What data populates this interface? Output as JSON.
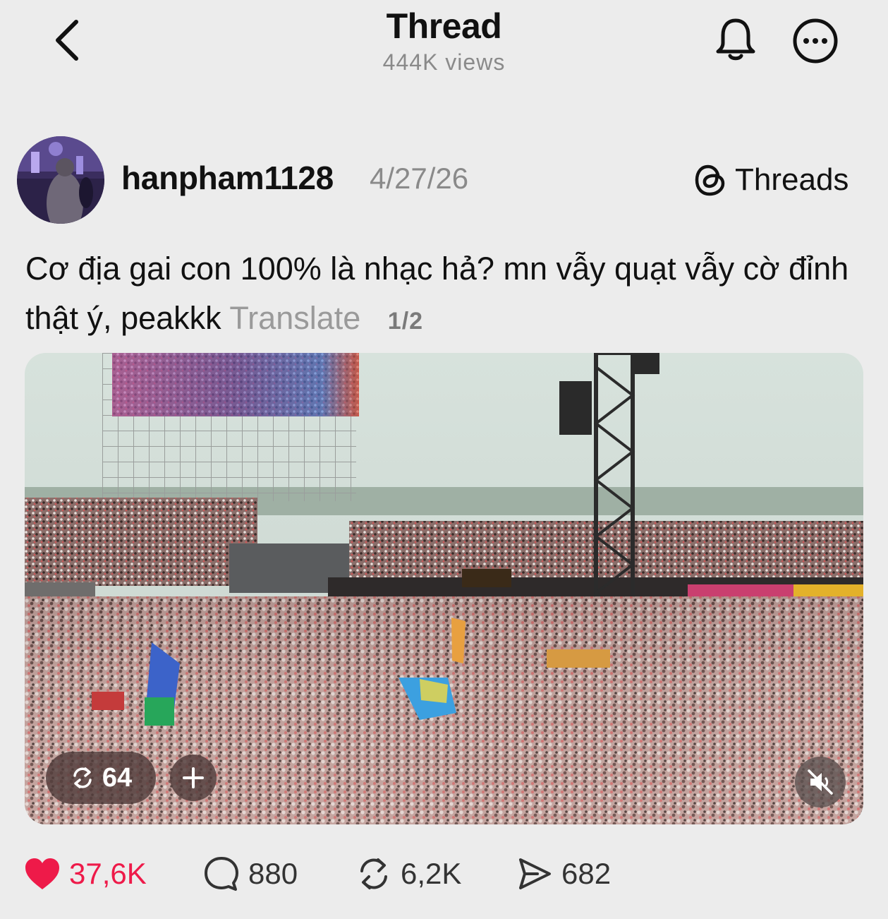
{
  "header": {
    "title": "Thread",
    "views": "444K views",
    "icons": [
      "back-chevron-icon",
      "bell-icon",
      "more-icon"
    ]
  },
  "post": {
    "username": "hanpham1128",
    "date": "4/27/26",
    "source_label": "Threads",
    "text": "Cơ địa gai con 100% là nhạc hả? mn vẫy quạt vẫy cờ đỉnh thật ý, peakkk",
    "translate_label": "Translate",
    "page_indicator": "1/2"
  },
  "media": {
    "repost_count": "64",
    "icons": [
      "repost-icon",
      "plus-icon",
      "muted-speaker-icon"
    ]
  },
  "actions": {
    "likes": "37,6K",
    "comments": "880",
    "reposts": "6,2K",
    "shares": "682"
  },
  "colors": {
    "background": "#ececec",
    "like": "#ee1a49",
    "muted_text": "#8a8a8a",
    "text": "#111111"
  }
}
